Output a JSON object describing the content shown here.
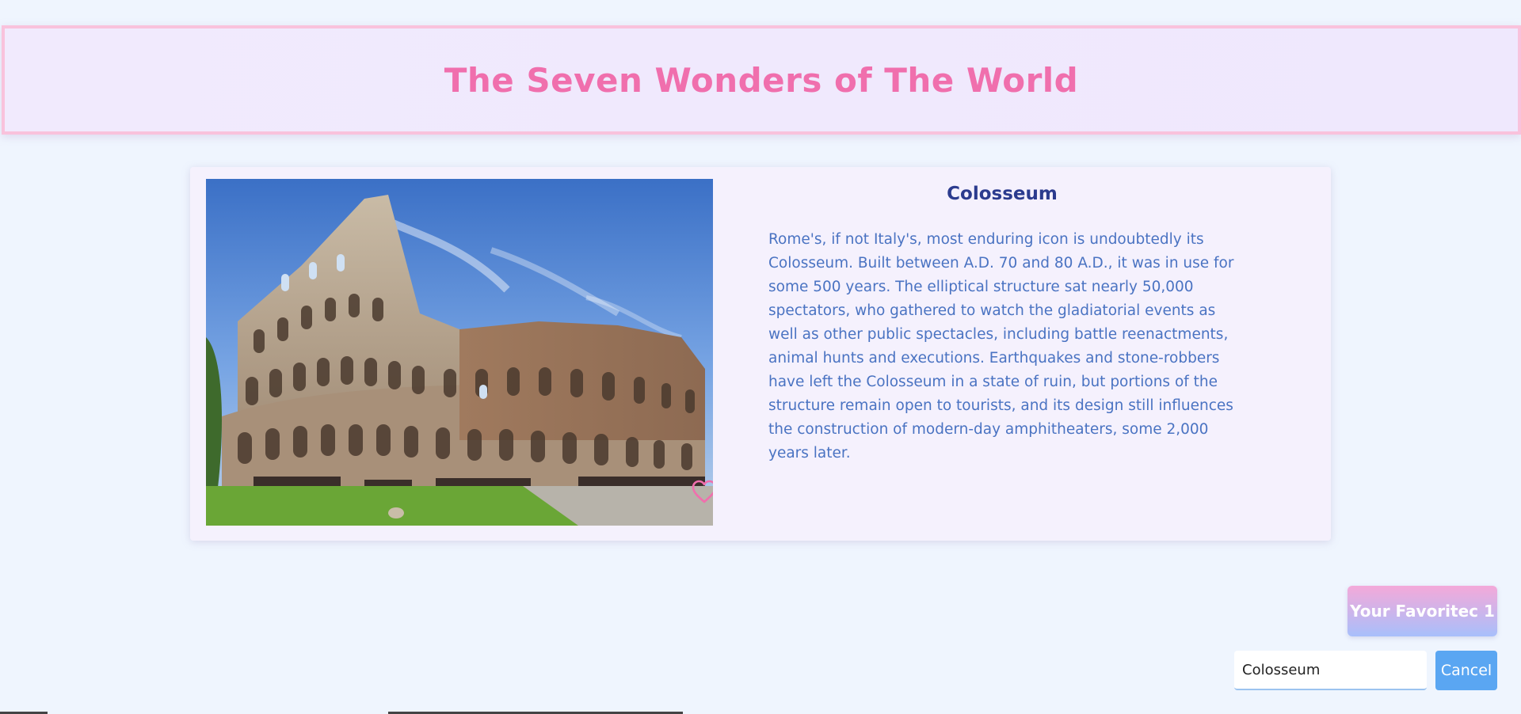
{
  "header": {
    "title": "The Seven Wonders of The World"
  },
  "card": {
    "title": "Colosseum",
    "description": "Rome's, if not Italy's, most enduring icon is undoubtedly its Colosseum. Built between A.D. 70 and 80 A.D., it was in use for some 500 years. The elliptical structure sat nearly 50,000 spectators, who gathered to watch the gladiatorial events as well as other public spectacles, including battle reenactments, animal hunts and executions. Earthquakes and stone-robbers have left the Colosseum in a state of ruin, but portions of the structure remain open to tourists, and its design still influences the construction of modern-day amphitheaters, some 2,000 years later.",
    "image_icon": "colosseum-photo",
    "favorite_icon": "heart-outline-icon"
  },
  "favorites": {
    "button_label": "Your Favoritec 1"
  },
  "editor": {
    "input_value": "Colosseum",
    "cancel_label": "Cancel"
  },
  "colors": {
    "title_pink": "#f06fad",
    "card_title": "#2b3b8e",
    "body_text": "#4a73c2",
    "cancel_blue": "#5aa6f2"
  }
}
